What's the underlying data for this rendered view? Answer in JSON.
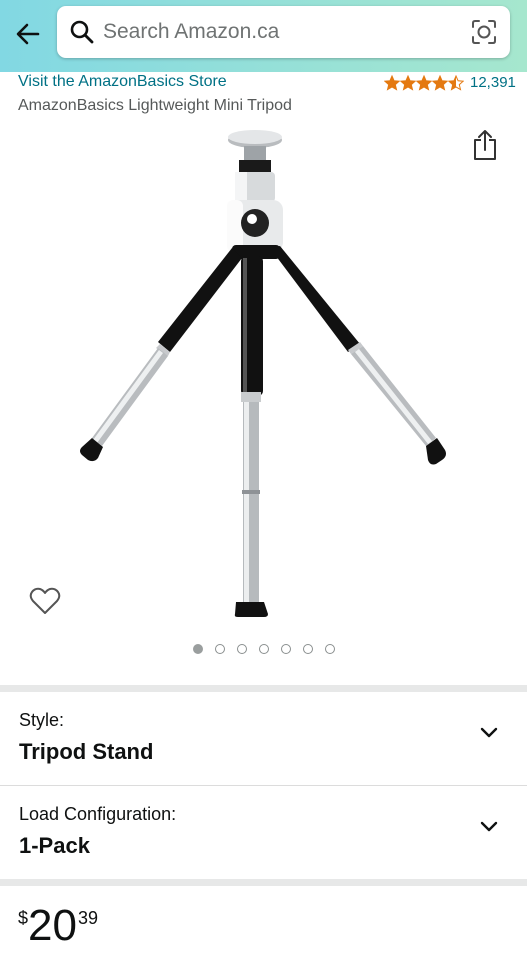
{
  "header": {
    "back_icon": "arrow-left-icon",
    "search": {
      "placeholder": "Search Amazon.ca",
      "value": ""
    },
    "lens_icon": "camera-lens-icon"
  },
  "product": {
    "store_link": "Visit the AmazonBasics Store",
    "title": "AmazonBasics Lightweight Mini Tripod",
    "rating": {
      "stars": 4.5,
      "count": "12,391"
    },
    "image_count": 7,
    "active_image": 1
  },
  "variations": [
    {
      "label": "Style:",
      "value": "Tripod Stand"
    },
    {
      "label": "Load Configuration:",
      "value": "1-Pack"
    }
  ],
  "price": {
    "symbol": "$",
    "whole": "20",
    "fraction": "39"
  },
  "colors": {
    "link": "#007185",
    "star": "#e47911",
    "header_start": "#82d8e3",
    "header_end": "#a6e7ce"
  }
}
